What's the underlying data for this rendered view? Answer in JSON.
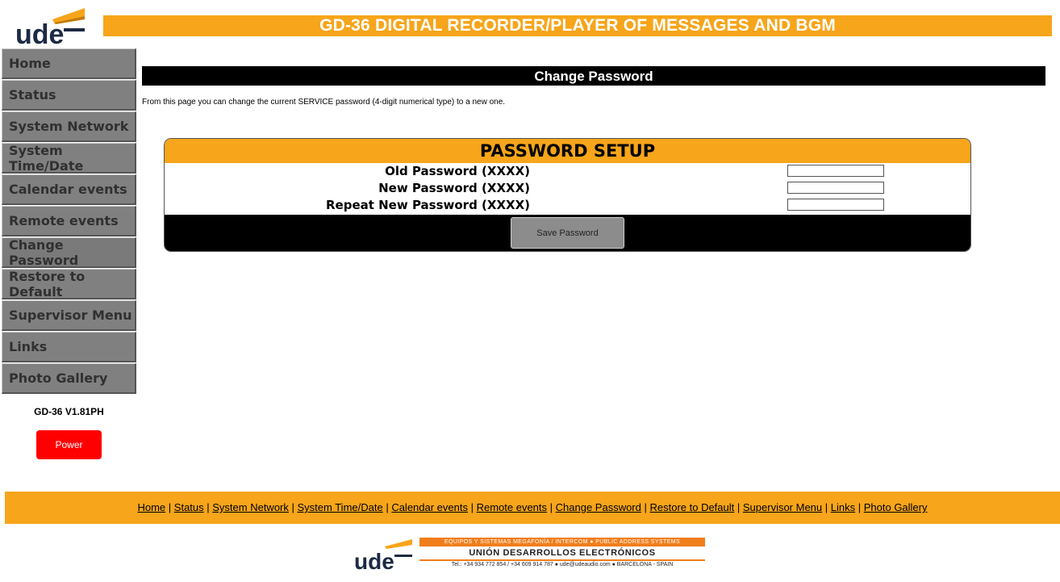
{
  "logo": {
    "text": "ude"
  },
  "header": {
    "title": "GD-36 DIGITAL RECORDER/PLAYER OF MESSAGES AND BGM"
  },
  "sidebar": {
    "items": [
      {
        "label": "Home"
      },
      {
        "label": "Status"
      },
      {
        "label": "System Network"
      },
      {
        "label": "System Time/Date"
      },
      {
        "label": "Calendar events"
      },
      {
        "label": "Remote events"
      },
      {
        "label": "Change Password"
      },
      {
        "label": "Restore to Default"
      },
      {
        "label": "Supervisor Menu"
      },
      {
        "label": "Links"
      },
      {
        "label": "Photo Gallery"
      }
    ],
    "version": "GD-36 V1.81PH",
    "power_label": "Power"
  },
  "main": {
    "title": "Change Password",
    "intro": "From this page you can change the current SERVICE password (4-digit numerical type) to a new one.",
    "setup": {
      "heading": "PASSWORD SETUP",
      "fields": [
        {
          "label": "Old Password (XXXX)",
          "value": ""
        },
        {
          "label": "New Password (XXXX)",
          "value": ""
        },
        {
          "label": "Repeat New Password (XXXX)",
          "value": ""
        }
      ],
      "save_label": "Save Password"
    }
  },
  "footer": {
    "links": [
      "Home",
      "Status",
      "System Network",
      "System Time/Date",
      "Calendar events",
      "Remote events",
      "Change Password",
      "Restore to Default",
      "Supervisor Menu",
      "Links",
      "Photo Gallery"
    ],
    "separator": " | "
  },
  "bottom_logo": {
    "mark": "ude",
    "tagline": "EQUIPOS Y SISTEMAS MEGAFONÍA / INTERCOM  ●  PUBLIC ADDRESS SYSTEMS",
    "company": "UNIÓN DESARROLLOS ELECTRÓNICOS",
    "contact": "Tel.: +34 934 772 854  / +34 609 914 787  ●  ude@udeaudio.com  ●  BARCELONA - SPAIN"
  },
  "colors": {
    "accent": "#f7a51a",
    "sidebar": "#808080",
    "power": "#ff0000",
    "bar": "#000000"
  }
}
